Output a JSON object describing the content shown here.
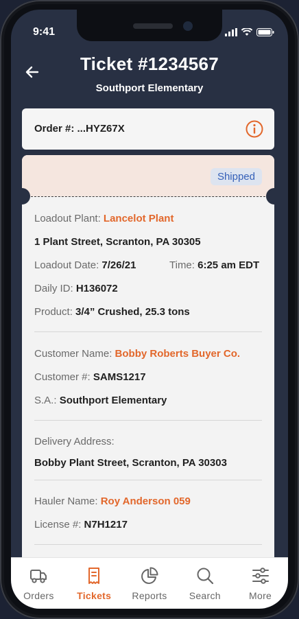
{
  "status": {
    "time": "9:41"
  },
  "header": {
    "title": "Ticket #1234567",
    "subtitle": "Southport Elementary"
  },
  "order": {
    "label": "Order #: ...HYZ67X"
  },
  "ticket": {
    "status_badge": "Shipped",
    "loadout_plant": {
      "key": "Loadout Plant: ",
      "value": "Lancelot Plant"
    },
    "plant_address": "1 Plant Street, Scranton, PA 30305",
    "loadout_date": {
      "key": "Loadout Date: ",
      "value": "7/26/21"
    },
    "time": {
      "key": "Time: ",
      "value": "6:25 am EDT"
    },
    "daily_id": {
      "key": "Daily ID: ",
      "value": "H136072"
    },
    "product": {
      "key": "Product: ",
      "value": "3/4” Crushed, 25.3 tons"
    },
    "customer_name": {
      "key": "Customer Name: ",
      "value": "Bobby Roberts Buyer Co."
    },
    "customer_number": {
      "key": "Customer #: ",
      "value": "SAMS1217"
    },
    "sa": {
      "key": "S.A.: ",
      "value": "Southport Elementary"
    },
    "delivery_address": {
      "key": "Delivery Address:",
      "value": "Bobby Plant Street, Scranton, PA 30303"
    },
    "hauler_name": {
      "key": "Hauler Name: ",
      "value": "Roy Anderson 059"
    },
    "license": {
      "key": "License #: ",
      "value": "N7H1217"
    }
  },
  "tabs": [
    {
      "label": "Orders",
      "icon": "truck-icon"
    },
    {
      "label": "Tickets",
      "icon": "ticket-icon",
      "active": true
    },
    {
      "label": "Reports",
      "icon": "pie-chart-icon"
    },
    {
      "label": "Search",
      "icon": "search-icon"
    },
    {
      "label": "More",
      "icon": "sliders-icon"
    }
  ],
  "colors": {
    "accent": "#e2672b",
    "badge_text": "#3560b8",
    "header_bg": "#283043"
  }
}
